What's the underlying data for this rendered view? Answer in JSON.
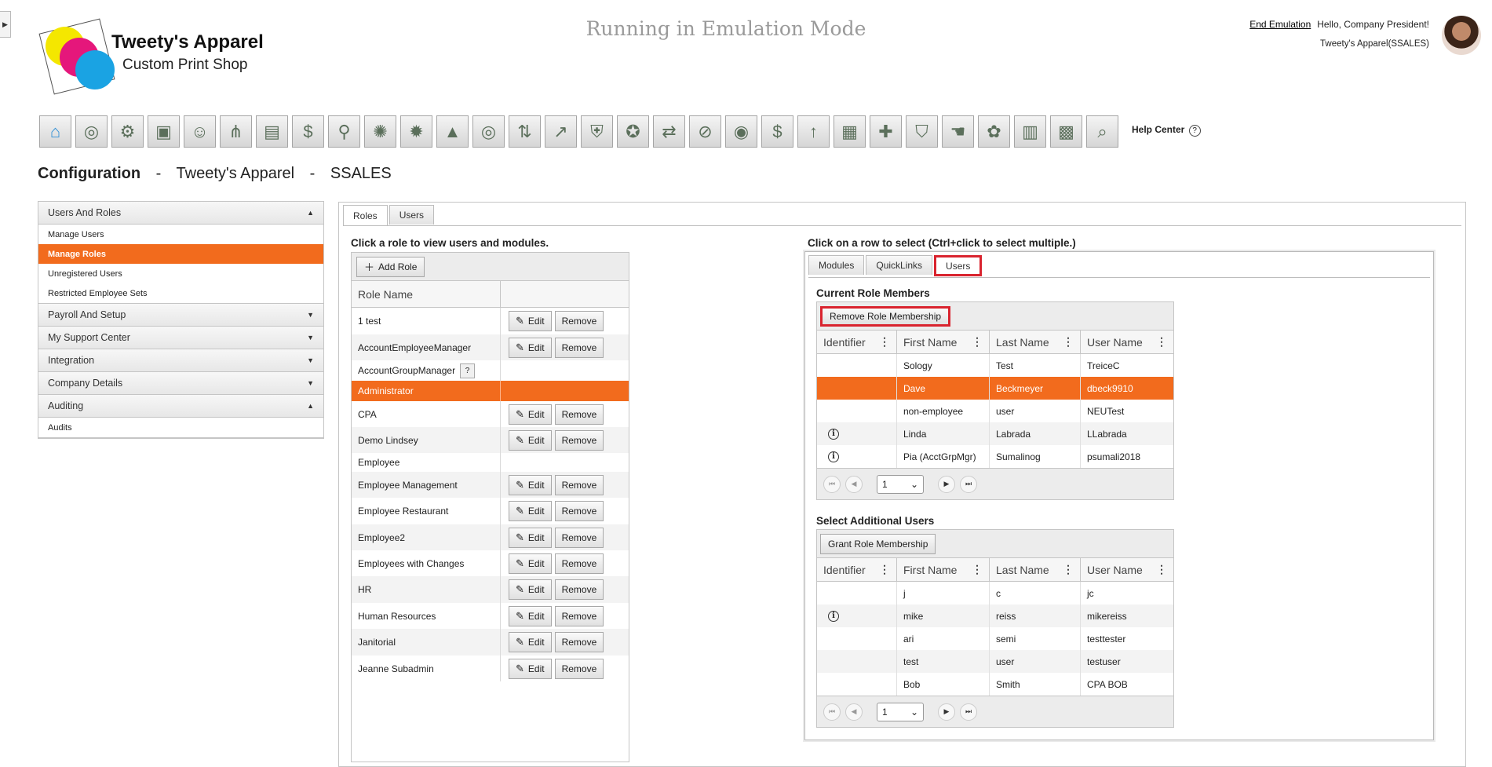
{
  "header": {
    "company_name": "Tweety's Apparel",
    "company_tagline": "Custom Print Shop",
    "emulation_banner": "Running in Emulation Mode",
    "end_emulation": "End Emulation",
    "greeting": "Hello, Company President!",
    "company_code": "Tweety's Apparel(SSALES)",
    "help_center": "Help Center"
  },
  "toolbar": {
    "icons": [
      "home-icon",
      "target-icon",
      "gear-people-icon",
      "presentation-icon",
      "team-icon",
      "org-chart-icon",
      "document-icon",
      "money-bag-icon",
      "search-person-icon",
      "target-gear-icon",
      "settings-icon",
      "growth-chart-icon",
      "target-icon",
      "transfer-icon",
      "person-arrow-icon",
      "shield-person-icon",
      "award-icon",
      "person-transfer-icon",
      "no-search-icon",
      "fingerprint-icon",
      "money-bag-icon",
      "person-up-icon",
      "grid-people-icon",
      "clipboard-add-icon",
      "shield-icon",
      "hand-pointer-icon",
      "gift-icon",
      "calculator-icon",
      "presentation-team-icon",
      "search-money-icon"
    ]
  },
  "page_title": {
    "section": "Configuration",
    "company": "Tweety's Apparel",
    "code": "SSALES",
    "separator": "-"
  },
  "sidebar": {
    "groups": [
      {
        "label": "Users And Roles",
        "expanded": true,
        "items": [
          "Manage Users",
          "Manage Roles",
          "Unregistered Users",
          "Restricted Employee Sets"
        ],
        "active": "Manage Roles"
      },
      {
        "label": "Payroll And Setup",
        "expanded": false
      },
      {
        "label": "My Support Center",
        "expanded": false
      },
      {
        "label": "Integration",
        "expanded": false
      },
      {
        "label": "Company Details",
        "expanded": false
      },
      {
        "label": "Auditing",
        "expanded": true,
        "items": [
          "Audits"
        ]
      }
    ]
  },
  "main": {
    "tabs": [
      "Roles",
      "Users"
    ],
    "active_tab": "Roles",
    "roles_instruction": "Click a role to view users and modules.",
    "add_role": "Add Role",
    "role_name_header": "Role Name",
    "edit_label": "Edit",
    "remove_label": "Remove",
    "help_badge": "?",
    "roles": [
      {
        "name": "1 test",
        "actions": true
      },
      {
        "name": "AccountEmployeeManager",
        "actions": true
      },
      {
        "name": "AccountGroupManager",
        "actions": false,
        "help": true
      },
      {
        "name": "Administrator",
        "actions": false,
        "selected": true
      },
      {
        "name": "CPA",
        "actions": true
      },
      {
        "name": "Demo Lindsey",
        "actions": true
      },
      {
        "name": "Employee",
        "actions": false
      },
      {
        "name": "Employee Management",
        "actions": true
      },
      {
        "name": "Employee Restaurant",
        "actions": true
      },
      {
        "name": "Employee2",
        "actions": true
      },
      {
        "name": "Employees with Changes",
        "actions": true
      },
      {
        "name": "HR",
        "actions": true
      },
      {
        "name": "Human Resources",
        "actions": true
      },
      {
        "name": "Janitorial",
        "actions": true
      },
      {
        "name": "Jeanne Subadmin",
        "actions": true
      }
    ]
  },
  "detail": {
    "instruction": "Click on a row to select (Ctrl+click to select multiple.)",
    "tabs": [
      "Modules",
      "QuickLinks",
      "Users"
    ],
    "active_tab": "Users",
    "current_members_title": "Current Role Members",
    "remove_membership": "Remove Role Membership",
    "additional_title": "Select Additional Users",
    "grant_membership": "Grant Role Membership",
    "columns": [
      "Identifier",
      "First Name",
      "Last Name",
      "User Name"
    ],
    "current_members": [
      {
        "info": false,
        "first": "Sology",
        "last": "Test",
        "user": "TreiceC"
      },
      {
        "info": false,
        "first": "Dave",
        "last": "Beckmeyer",
        "user": "dbeck9910",
        "selected": true
      },
      {
        "info": false,
        "first": "non-employee",
        "last": "user",
        "user": "NEUTest"
      },
      {
        "info": true,
        "first": "Linda",
        "last": "Labrada",
        "user": "LLabrada"
      },
      {
        "info": true,
        "first": "Pia (AcctGrpMgr)",
        "last": "Sumalinog",
        "user": "psumali2018"
      }
    ],
    "additional_users": [
      {
        "info": false,
        "first": "j",
        "last": "c",
        "user": "jc"
      },
      {
        "info": true,
        "first": "mike",
        "last": "reiss",
        "user": "mikereiss"
      },
      {
        "info": false,
        "first": "ari",
        "last": "semi",
        "user": "testtester"
      },
      {
        "info": false,
        "first": "test",
        "last": "user",
        "user": "testuser"
      },
      {
        "info": false,
        "first": "Bob",
        "last": "Smith",
        "user": "CPA BOB"
      }
    ],
    "page_value": "1"
  },
  "colors": {
    "accent": "#f26b1d",
    "highlight": "#d9232e"
  }
}
